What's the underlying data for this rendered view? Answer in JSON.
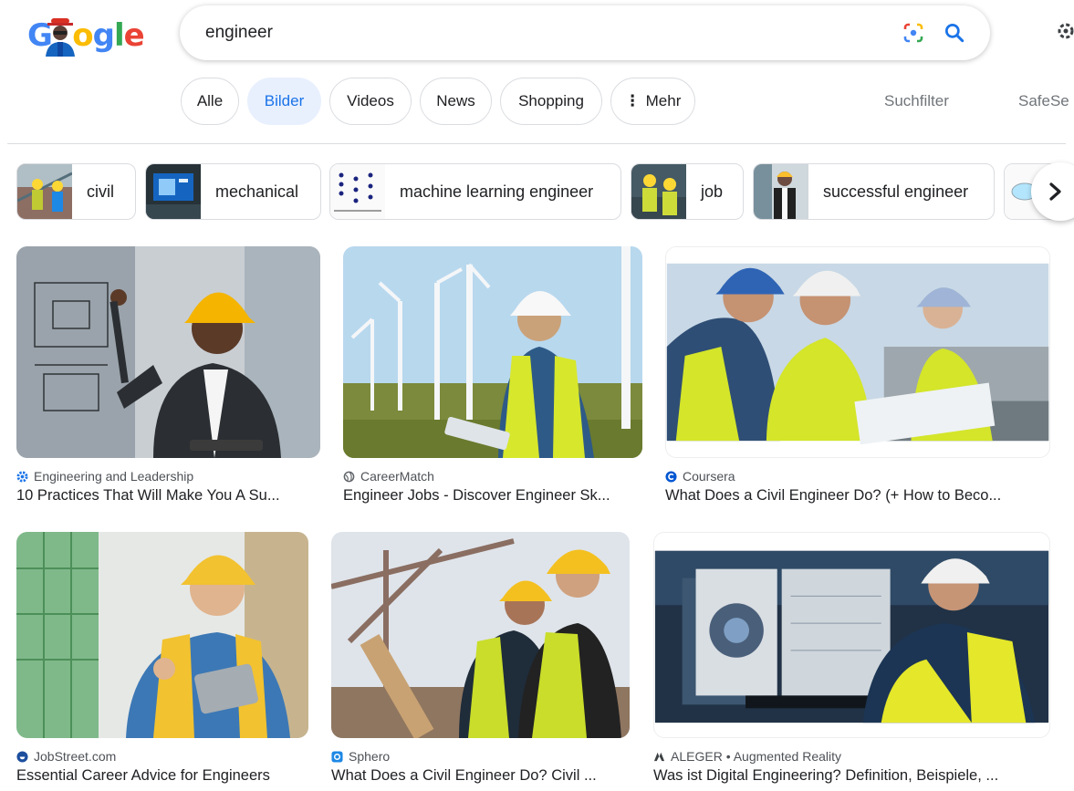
{
  "logo": {
    "letters": [
      "G",
      "o",
      "o",
      "g",
      "l",
      "e"
    ]
  },
  "search": {
    "query": "engineer",
    "placeholder": ""
  },
  "tabs": [
    {
      "label": "Alle",
      "active": false
    },
    {
      "label": "Bilder",
      "active": true
    },
    {
      "label": "Videos",
      "active": false
    },
    {
      "label": "News",
      "active": false
    },
    {
      "label": "Shopping",
      "active": false
    },
    {
      "label": "Mehr",
      "active": false
    }
  ],
  "tools": {
    "filter_label": "Suchfilter",
    "safesearch_label": "SafeSe"
  },
  "chips": [
    {
      "label": "civil"
    },
    {
      "label": "mechanical"
    },
    {
      "label": "machine learning engineer"
    },
    {
      "label": "job"
    },
    {
      "label": "successful engineer"
    }
  ],
  "results": [
    {
      "source": "Engineering and Leadership",
      "title": "10 Practices That Will Make You A Su...",
      "icon": "gear-icon"
    },
    {
      "source": "CareerMatch",
      "title": "Engineer Jobs - Discover Engineer Sk...",
      "icon": "globe-icon"
    },
    {
      "source": "Coursera",
      "title": "What Does a Civil Engineer Do? (+ How to Beco...",
      "icon": "coursera-icon"
    },
    {
      "source": "JobStreet.com",
      "title": "Essential Career Advice for Engineers",
      "icon": "jobstreet-icon"
    },
    {
      "source": "Sphero",
      "title": "What Does a Civil Engineer Do? Civil ...",
      "icon": "sphero-icon"
    },
    {
      "source": "ALEGER • Augmented Reality",
      "title": "Was ist Digital Engineering? Definition, Beispiele, ...",
      "icon": "aleger-icon"
    }
  ],
  "colors": {
    "accent": "#1a73e8",
    "active_tab_bg": "#e8f0fe",
    "border": "#dadce0",
    "source_text": "#4d5156"
  }
}
